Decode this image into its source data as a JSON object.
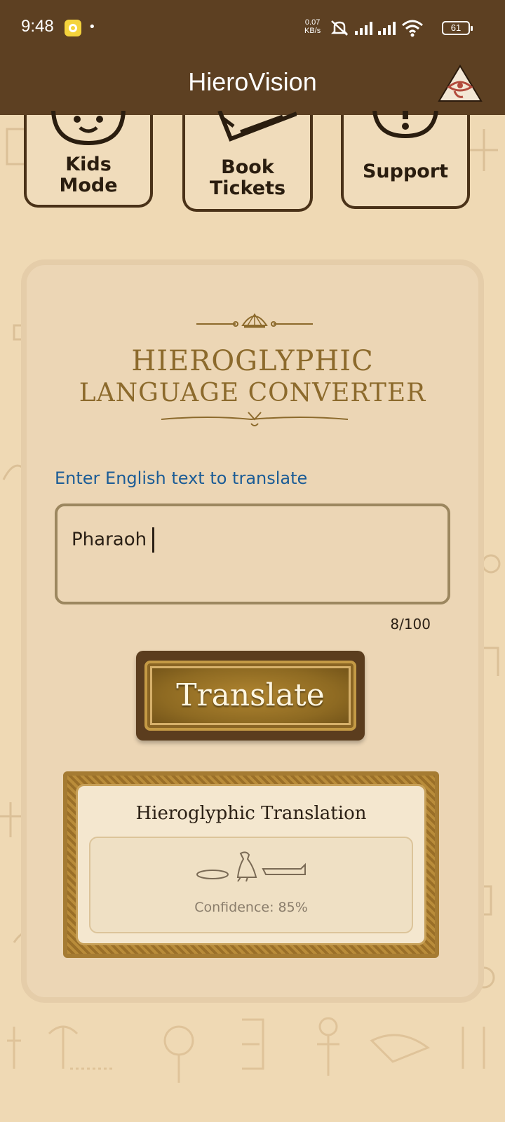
{
  "status_bar": {
    "time": "9:48",
    "speed_value": "0.07",
    "speed_unit": "KB/s",
    "battery": "61"
  },
  "app_bar": {
    "title": "HieroVision",
    "logo_icon": "eye-of-ra-pyramid-icon"
  },
  "quick_actions": [
    {
      "line1": "Kids",
      "line2": "Mode",
      "icon": "child-face-icon"
    },
    {
      "line1": "Book",
      "line2": "Tickets",
      "icon": "ticket-icon"
    },
    {
      "line1": "Support",
      "line2": "",
      "icon": "help-icon"
    }
  ],
  "converter": {
    "title_line1": "HIEROGLYPHIC",
    "title_line2": "LANGUAGE CONVERTER",
    "input_label": "Enter English text to translate",
    "input_value": "Pharaoh",
    "char_count": "8/100",
    "translate_label": "Translate",
    "result_title": "Hieroglyphic Translation",
    "confidence": "Confidence: 85%"
  },
  "colors": {
    "primary_brown": "#5d4022",
    "background": "#efd9b4",
    "label_blue": "#1b5c96",
    "gold": "#8c6a2c"
  }
}
